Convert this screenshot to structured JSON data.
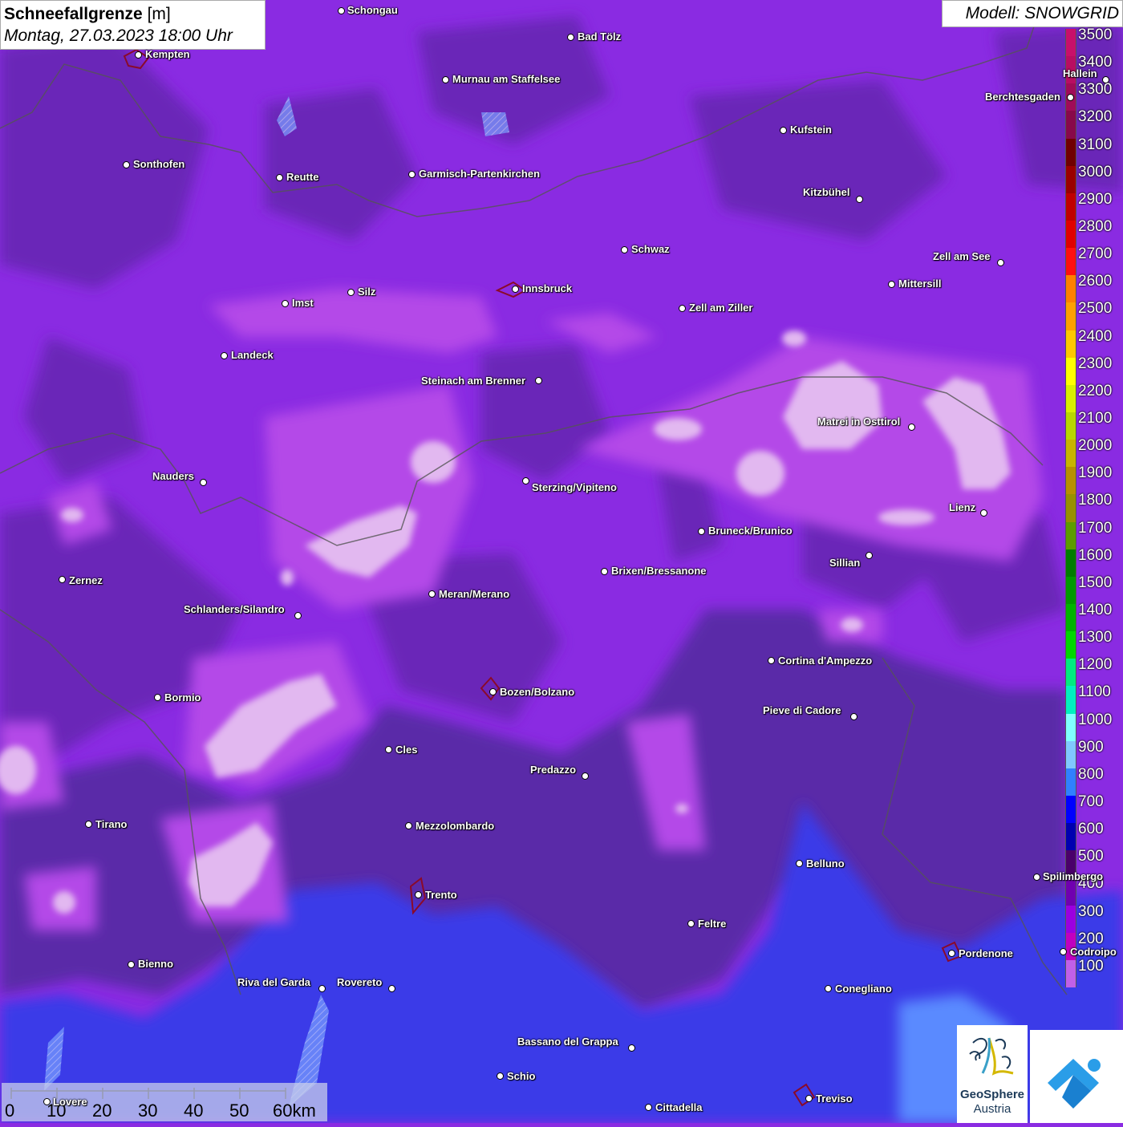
{
  "title": {
    "main": "Schneefallgrenze",
    "unit": "[m]",
    "datetime": "Montag, 27.03.2023 18:00 Uhr"
  },
  "model": "Modell: SNOWGRID",
  "legend": {
    "labels": [
      "3500",
      "3400",
      "3300",
      "3200",
      "3100",
      "3000",
      "2900",
      "2800",
      "2700",
      "2600",
      "2500",
      "2400",
      "2300",
      "2200",
      "2100",
      "2000",
      "1900",
      "1800",
      "1700",
      "1600",
      "1500",
      "1400",
      "1300",
      "1200",
      "1100",
      "1000",
      "900",
      "800",
      "700",
      "600",
      "500",
      "400",
      "300",
      "200",
      "100"
    ],
    "colors": [
      "#c8106a",
      "#b80e62",
      "#a00c58",
      "#88094a",
      "#700000",
      "#9a0000",
      "#c00000",
      "#e00000",
      "#ff1010",
      "#ff8000",
      "#ffa000",
      "#ffc800",
      "#ffff00",
      "#d8f000",
      "#b8d800",
      "#c8b400",
      "#b89000",
      "#989000",
      "#5c9c00",
      "#007c00",
      "#009a00",
      "#00b400",
      "#00d800",
      "#00ec80",
      "#00f0c0",
      "#80ffff",
      "#80c8ff",
      "#3080ff",
      "#0000ff",
      "#0000b0",
      "#4a006a",
      "#7000b0",
      "#9a00e0",
      "#c000c0",
      "#c060e8"
    ]
  },
  "cities": [
    {
      "name": "Schongau"
    },
    {
      "name": "Bad Tölz"
    },
    {
      "name": "Kempten"
    },
    {
      "name": "Murnau am Staffelsee"
    },
    {
      "name": "Hallein"
    },
    {
      "name": "Berchtesgaden"
    },
    {
      "name": "Kufstein"
    },
    {
      "name": "Sonthofen"
    },
    {
      "name": "Reutte"
    },
    {
      "name": "Garmisch-Partenkirchen"
    },
    {
      "name": "Kitzbühel"
    },
    {
      "name": "Schwaz"
    },
    {
      "name": "Zell am See"
    },
    {
      "name": "Innsbruck"
    },
    {
      "name": "Mittersill"
    },
    {
      "name": "Silz"
    },
    {
      "name": "Imst"
    },
    {
      "name": "Zell am Ziller"
    },
    {
      "name": "Landeck"
    },
    {
      "name": "Steinach am Brenner"
    },
    {
      "name": "Matrei in Osttirol"
    },
    {
      "name": "Nauders"
    },
    {
      "name": "Sterzing/Vipiteno"
    },
    {
      "name": "Lienz"
    },
    {
      "name": "Bruneck/Brunico"
    },
    {
      "name": "Sillian"
    },
    {
      "name": "Brixen/Bressanone"
    },
    {
      "name": "Zernez"
    },
    {
      "name": "Meran/Merano"
    },
    {
      "name": "Schlanders/Silandro"
    },
    {
      "name": "Cortina d'Ampezzo"
    },
    {
      "name": "Bozen/Bolzano"
    },
    {
      "name": "Bormio"
    },
    {
      "name": "Pieve di Cadore"
    },
    {
      "name": "Cles"
    },
    {
      "name": "Predazzo"
    },
    {
      "name": "Tirano"
    },
    {
      "name": "Mezzolombardo"
    },
    {
      "name": "Belluno"
    },
    {
      "name": "Spilimbergo"
    },
    {
      "name": "Trento"
    },
    {
      "name": "Feltre"
    },
    {
      "name": "Pordenone"
    },
    {
      "name": "Codroipo"
    },
    {
      "name": "Bienno"
    },
    {
      "name": "Riva del Garda"
    },
    {
      "name": "Rovereto"
    },
    {
      "name": "Conegliano"
    },
    {
      "name": "Bassano del Grappa"
    },
    {
      "name": "Schio"
    },
    {
      "name": "Lovere"
    },
    {
      "name": "Treviso"
    },
    {
      "name": "Cittadella"
    }
  ],
  "scale": {
    "labels": [
      "0",
      "10",
      "20",
      "30",
      "40",
      "50",
      "60km"
    ]
  },
  "logos": {
    "geosphere_line1": "GeoSphere",
    "geosphere_line2": "Austria"
  },
  "colors": {
    "base_purple": "#8a2be2",
    "dark_purple": "#5c2a9e",
    "blue_low": "#3a3ae8",
    "pink_high": "#c855e0",
    "light_high": "#e2b8f0"
  }
}
